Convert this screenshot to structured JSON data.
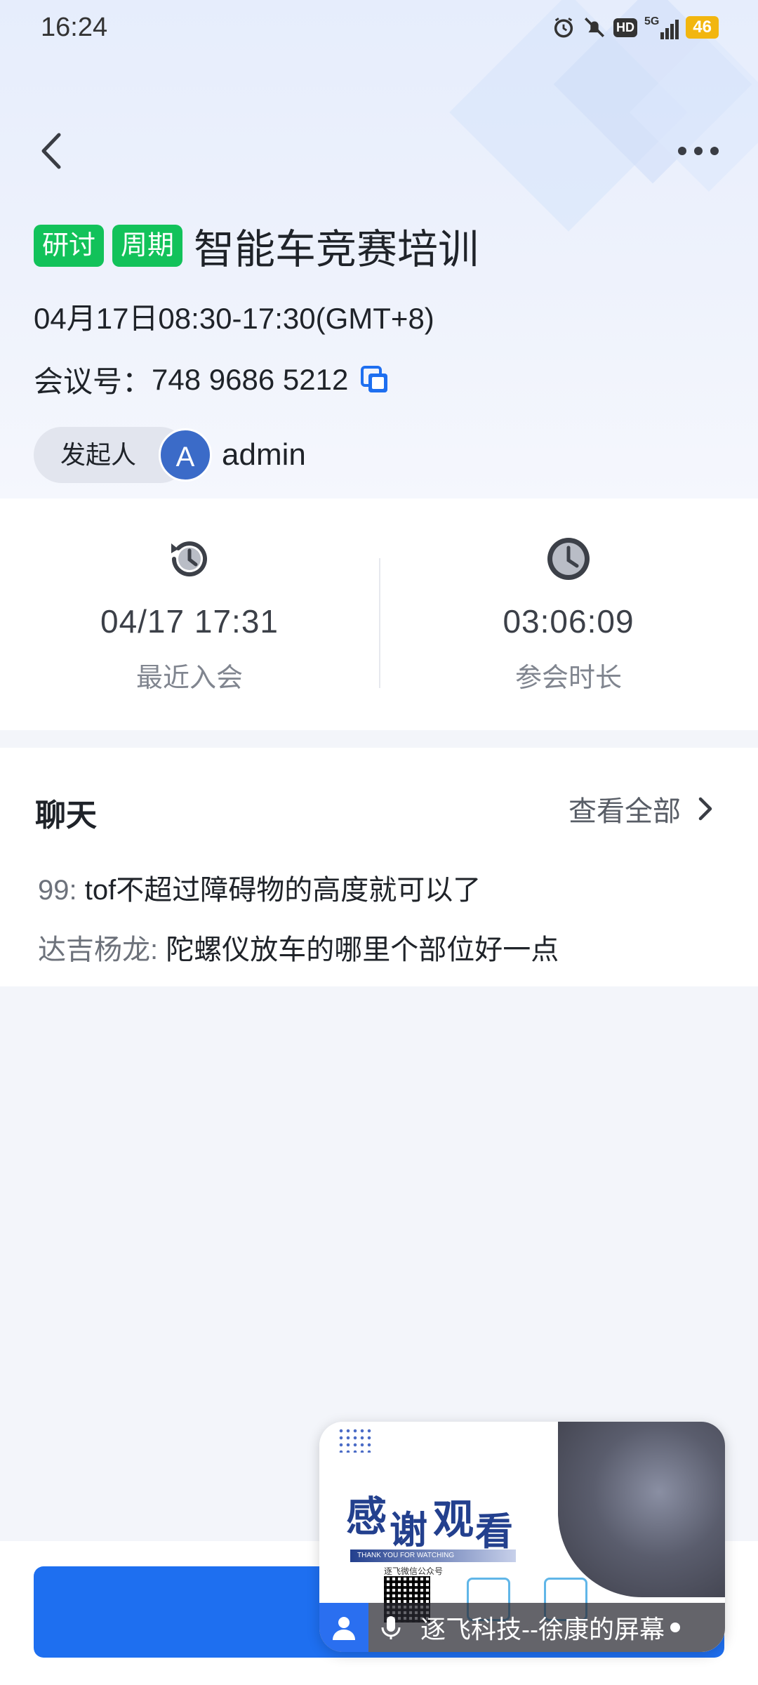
{
  "status_bar": {
    "time": "16:24",
    "network": "5G",
    "hd": "HD",
    "battery": "46"
  },
  "meeting": {
    "tags": [
      "研讨",
      "周期"
    ],
    "title": "智能车竞赛培训",
    "time_range": "04月17日08:30-17:30(GMT+8)",
    "id_label": "会议号：",
    "id_value": "748 9686 5212",
    "host_label": "发起人",
    "host_avatar_letter": "A",
    "host_name": "admin"
  },
  "stats": {
    "last_join_value": "04/17 17:31",
    "last_join_label": "最近入会",
    "duration_value": "03:06:09",
    "duration_label": "参会时长"
  },
  "chat": {
    "title": "聊天",
    "view_all": "查看全部",
    "messages": [
      {
        "sender": "99:",
        "text": "tof不超过障碍物的高度就可以了"
      },
      {
        "sender": "达吉杨龙:",
        "text": "陀螺仪放车的哪里个部位好一点"
      }
    ]
  },
  "floating_window": {
    "slide_title_1": "感",
    "slide_title_2": "谢",
    "slide_title_3": "观",
    "slide_title_4": "看",
    "slide_subtitle": "THANK YOU FOR WATCHING",
    "slide_official": "逐飞微信公众号",
    "caption": "逐飞科技--徐康的屏幕"
  },
  "colors": {
    "tag_green": "#12c25a",
    "primary_blue": "#1e6ff0",
    "avatar_blue": "#3b6bc8"
  },
  "icons": {
    "back": "chevron-left-icon",
    "more": "more-dots-icon",
    "copy": "copy-icon",
    "history": "history-clock-icon",
    "clock": "clock-icon",
    "chevron": "chevron-right-icon",
    "person": "person-icon",
    "mic": "mic-icon"
  }
}
